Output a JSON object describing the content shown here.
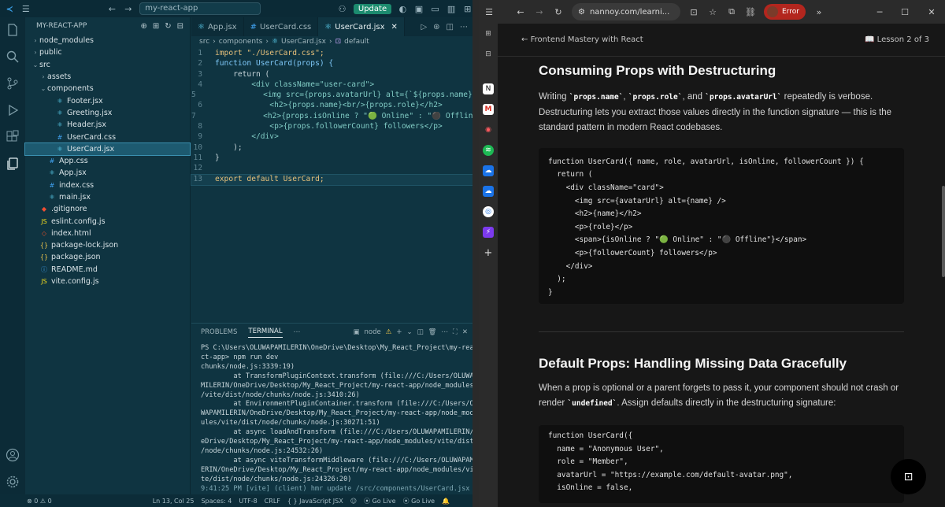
{
  "vscode": {
    "titlebar": {
      "search": "my-react-app",
      "update_label": "Update"
    },
    "explorer": {
      "title": "MY-REACT-APP",
      "items": [
        {
          "label": "node_modules",
          "depth": 0,
          "kind": "folder",
          "open": false
        },
        {
          "label": "public",
          "depth": 0,
          "kind": "folder",
          "open": false
        },
        {
          "label": "src",
          "depth": 0,
          "kind": "folder",
          "open": true
        },
        {
          "label": "assets",
          "depth": 1,
          "kind": "folder",
          "open": false
        },
        {
          "label": "components",
          "depth": 1,
          "kind": "folder",
          "open": true
        },
        {
          "label": "Footer.jsx",
          "depth": 2,
          "kind": "jsx"
        },
        {
          "label": "Greeting.jsx",
          "depth": 2,
          "kind": "jsx"
        },
        {
          "label": "Header.jsx",
          "depth": 2,
          "kind": "jsx"
        },
        {
          "label": "UserCard.css",
          "depth": 2,
          "kind": "css"
        },
        {
          "label": "UserCard.jsx",
          "depth": 2,
          "kind": "jsx",
          "selected": true
        },
        {
          "label": "App.css",
          "depth": 1,
          "kind": "css"
        },
        {
          "label": "App.jsx",
          "depth": 1,
          "kind": "jsx"
        },
        {
          "label": "index.css",
          "depth": 1,
          "kind": "css"
        },
        {
          "label": "main.jsx",
          "depth": 1,
          "kind": "jsx"
        },
        {
          "label": ".gitignore",
          "depth": 0,
          "kind": "git"
        },
        {
          "label": "eslint.config.js",
          "depth": 0,
          "kind": "js"
        },
        {
          "label": "index.html",
          "depth": 0,
          "kind": "html"
        },
        {
          "label": "package-lock.json",
          "depth": 0,
          "kind": "json"
        },
        {
          "label": "package.json",
          "depth": 0,
          "kind": "json"
        },
        {
          "label": "README.md",
          "depth": 0,
          "kind": "md"
        },
        {
          "label": "vite.config.js",
          "depth": 0,
          "kind": "js"
        }
      ]
    },
    "tabs": [
      {
        "label": "App.jsx",
        "active": false
      },
      {
        "label": "UserCard.css",
        "active": false
      },
      {
        "label": "UserCard.jsx",
        "active": true
      }
    ],
    "breadcrumb": {
      "p1": "src",
      "p2": "components",
      "p3": "UserCard.jsx",
      "p4": "default"
    },
    "code": [
      {
        "n": "1",
        "t": "import \"./UserCard.css\";"
      },
      {
        "n": "2",
        "t": "function UserCard(props) {"
      },
      {
        "n": "3",
        "t": "    return ("
      },
      {
        "n": "4",
        "t": "        <div className=\"user-card\">"
      },
      {
        "n": "5",
        "t": "            <img src={props.avatarUrl} alt={`${props.name}`} />"
      },
      {
        "n": "6",
        "t": "            <h2>{props.name}<br/>{props.role}</h2>"
      },
      {
        "n": "7",
        "t": "            <h2>{props.isOnline ? \"🟢 Online\" : \"⚫ Offline\"}</h2>"
      },
      {
        "n": "8",
        "t": "            <p>{props.followerCount} followers</p>"
      },
      {
        "n": "9",
        "t": "        </div>"
      },
      {
        "n": "10",
        "t": "    );"
      },
      {
        "n": "11",
        "t": "}"
      },
      {
        "n": "12",
        "t": ""
      },
      {
        "n": "13",
        "t": "export default UserCard;"
      }
    ],
    "panel": {
      "tab_problems": "PROBLEMS",
      "tab_terminal": "TERMINAL",
      "node_label": "node",
      "lines": [
        "PS C:\\Users\\OLUWAPAMILERIN\\OneDrive\\Desktop\\My_React_Project\\my-rea",
        "ct-app> npm run dev",
        "chunks/node.js:3339:19)",
        "        at TransformPluginContext.transform (file:///C:/Users/OLUWAPA",
        "MILERIN/OneDrive/Desktop/My_React_Project/my-react-app/node_modules",
        "/vite/dist/node/chunks/node.js:3410:26)",
        "        at EnvironmentPluginContainer.transform (file:///C:/Users/OLU",
        "WAPAMILERIN/OneDrive/Desktop/My_React_Project/my-react-app/node_mod",
        "ules/vite/dist/node/chunks/node.js:30271:51)",
        "        at async loadAndTransform (file:///C:/Users/OLUWAPAMILERIN/On",
        "eDrive/Desktop/My_React_Project/my-react-app/node_modules/vite/dist",
        "/node/chunks/node.js:24532:26)",
        "        at async viteTransformMiddleware (file:///C:/Users/OLUWAPAMIL",
        "ERIN/OneDrive/Desktop/My_React_Project/my-react-app/node_modules/vi",
        "te/dist/node/chunks/node.js:24326:20)",
        "9:41:25 PM [vite] (client) hmr update /src/components/UserCard.jsx"
      ]
    },
    "status": {
      "errors": "0",
      "warnings": "0",
      "position": "Ln 13, Col 25",
      "spaces": "Spaces: 4",
      "encoding": "UTF-8",
      "eol": "CRLF",
      "language": "JavaScript JSX",
      "golive1": "Go Live",
      "golive2": "Go Live"
    }
  },
  "browser": {
    "url": "nannoy.com/learni...",
    "error_label": "Error",
    "lesson": {
      "back_label": "Frontend Mastery with React",
      "progress": "Lesson 2 of 3"
    },
    "section1": {
      "title": "Consuming Props with Destructuring",
      "p_a": "Writing ",
      "c1": "`props.name`",
      "c2": "`props.role`",
      "p_and": ", and ",
      "c3": "`props.avatarUrl`",
      "p_b": " repeatedly is verbose. Destructuring lets you extract those values directly in the function signature — this is the standard pattern in modern React codebases.",
      "code": "function UserCard({ name, role, avatarUrl, isOnline, followerCount }) {\n  return (\n    <div className=\"card\">\n      <img src={avatarUrl} alt={name} />\n      <h2>{name}</h2>\n      <p>{role}</p>\n      <span>{isOnline ? \"🟢 Online\" : \"⚫ Offline\"}</span>\n      <p>{followerCount} followers</p>\n    </div>\n  );\n}"
    },
    "section2": {
      "title": "Default Props: Handling Missing Data Gracefully",
      "p_a": "When a prop is optional or a parent forgets to pass it, your component should not crash or render ",
      "c1": "`undefined`",
      "p_b": ". Assign defaults directly in the destructuring signature:",
      "code": "function UserCard({\n  name = \"Anonymous User\",\n  role = \"Member\",\n  avatarUrl = \"https://example.com/default-avatar.png\",\n  isOnline = false,"
    }
  }
}
